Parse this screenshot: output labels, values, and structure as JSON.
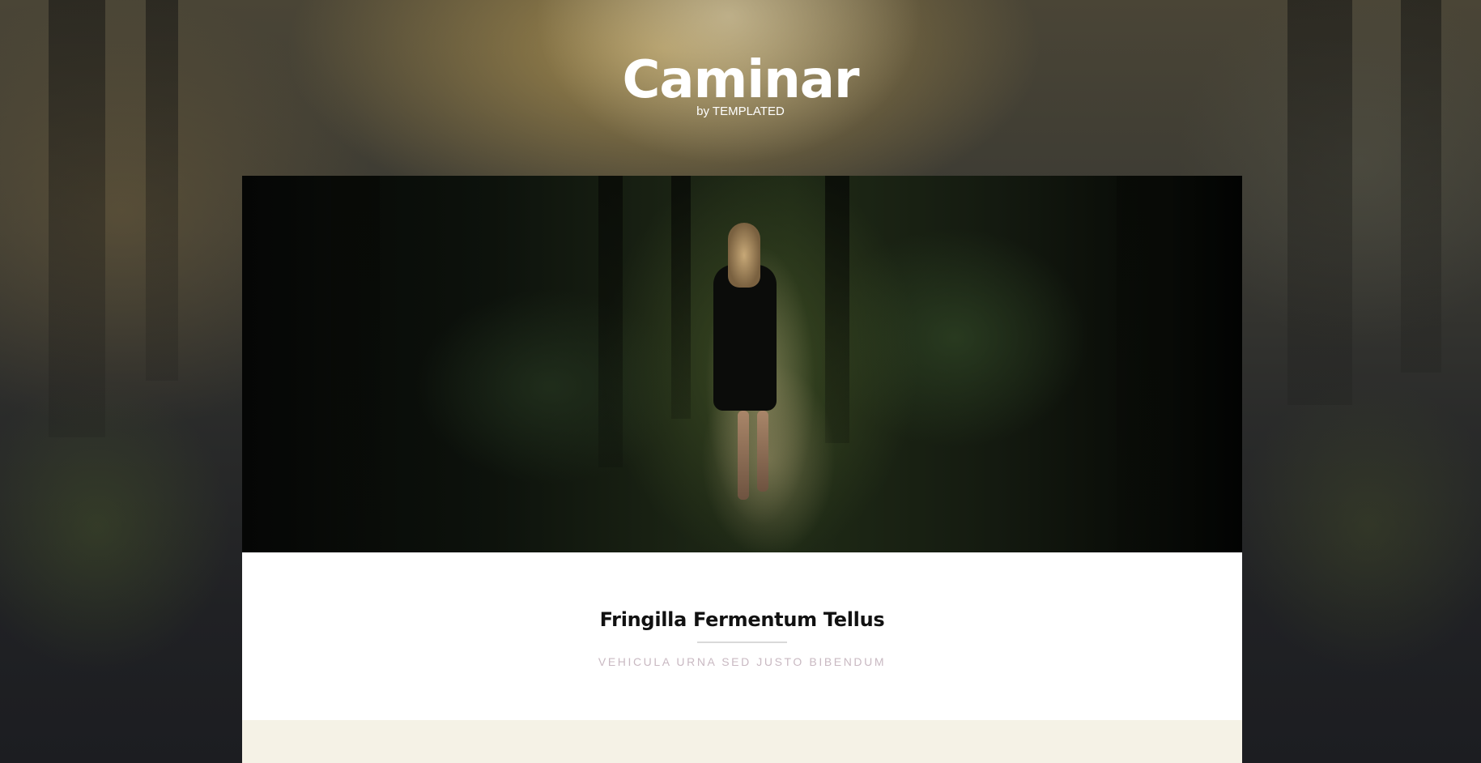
{
  "header": {
    "title": "Caminar",
    "byline": "by TEMPLATED"
  },
  "hero": {
    "image_alt": "Woman walking along a forest path"
  },
  "article": {
    "title": "Fringilla Fermentum Tellus",
    "subtitle": "Vehicula urna sed justo bibendum"
  },
  "colors": {
    "background": "#1d1e22",
    "card": "#ffffff",
    "band": "#f5f2e6",
    "subtitle": "#c9b9c2",
    "title": "#111111"
  }
}
